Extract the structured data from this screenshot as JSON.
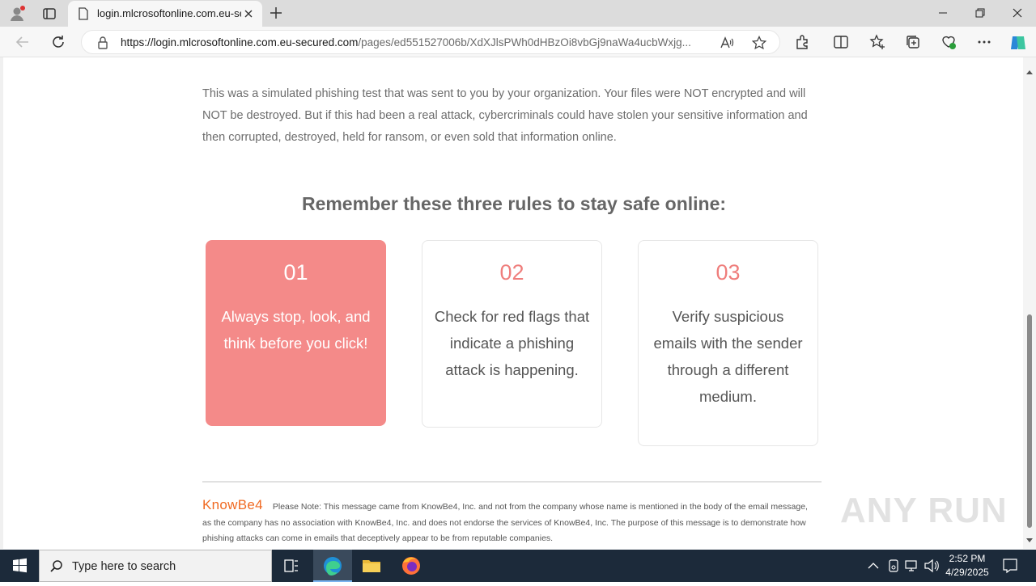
{
  "browser": {
    "tab_title": "login.mlcrosoftonline.com.eu-se",
    "url_host": "https://login.mlcrosoftonline.com.eu-secured.com",
    "url_path": "/pages/ed551527006b/XdXJlsPWh0dHBzOi8vbGj9naWa4ucbWxjg..."
  },
  "page": {
    "intro": "This was a simulated phishing test that was sent to you by your organization. Your files were NOT encrypted and will NOT be destroyed. But if this had been a real attack, cybercriminals could have stolen your sensitive information and then corrupted, destroyed, held for ransom, or even sold that information online.",
    "heading": "Remember these three rules to stay safe online:",
    "rules": [
      {
        "num": "01",
        "text": "Always stop, look, and think before you click!"
      },
      {
        "num": "02",
        "text": "Check for red flags that indicate a phishing attack is happening."
      },
      {
        "num": "03",
        "text": "Verify suspicious emails with the sender through a different medium."
      }
    ],
    "footer_logo": "KnowBe4",
    "footer_note": "Please Note: This message came from KnowBe4, Inc. and not from the company whose name is mentioned in the body of the email message, as the company has no association with KnowBe4, Inc. and does not endorse the services of KnowBe4, Inc. The purpose of this message is to demonstrate how phishing attacks can come in emails that deceptively appear to be from reputable companies.",
    "watermark": "ANY RUN"
  },
  "taskbar": {
    "search_placeholder": "Type here to search",
    "time": "2:52 PM",
    "date": "4/29/2025"
  },
  "colors": {
    "accent_card": "#f48a89",
    "number_color": "#ef7e7c",
    "logo_orange": "#f06a22"
  }
}
